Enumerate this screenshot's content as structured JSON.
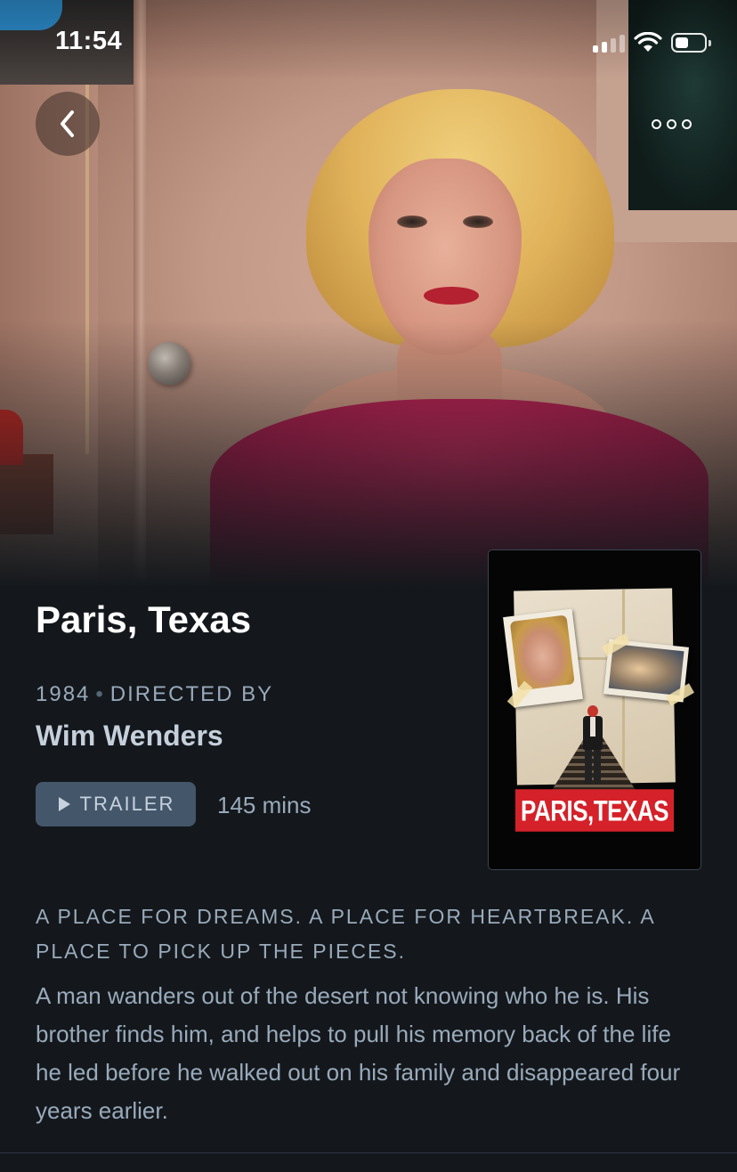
{
  "status_bar": {
    "time": "11:54"
  },
  "nav": {
    "back_icon": "chevron-left-icon",
    "more_icon": "more-horizontal-icon"
  },
  "film": {
    "title": "Paris, Texas",
    "year": "1984",
    "directed_by_label": "DIRECTED BY",
    "director": "Wim Wenders",
    "trailer_label": "TRAILER",
    "runtime": "145 mins",
    "tagline": "A PLACE FOR DREAMS. A PLACE FOR HEARTBREAK. A PLACE TO PICK UP THE PIECES.",
    "synopsis": "A man wanders out of the desert not knowing who he is. His brother finds him, and helps to pull his memory back of the life he led before he walked out on his family and disappeared four years earlier.",
    "poster_title": "PARIS,TEXAS"
  },
  "colors": {
    "background": "#14181c",
    "muted_text": "#99aabb",
    "trailer_button": "#44566a",
    "poster_red": "#d52129"
  }
}
